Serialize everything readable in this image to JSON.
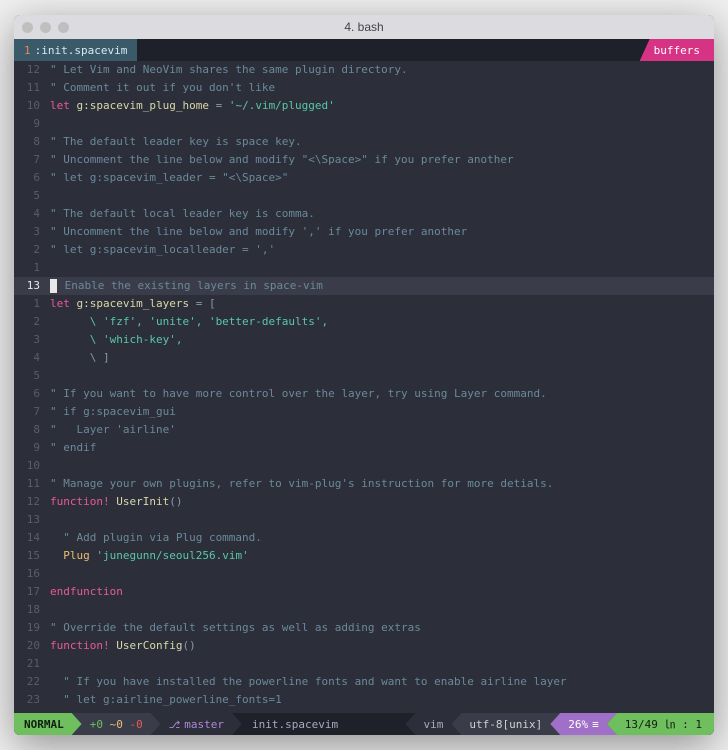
{
  "window": {
    "title": "4. bash"
  },
  "tab": {
    "index": "1",
    "name": "init.spacevim",
    "right_label": "buffers"
  },
  "lines": [
    {
      "n": "12",
      "t": "comment",
      "text": "\" Let Vim and NeoVim shares the same plugin directory."
    },
    {
      "n": "11",
      "t": "comment",
      "text": "\" Comment it out if you don't like"
    },
    {
      "n": "10",
      "t": "let",
      "kw": "let",
      "id": " g:spacevim_plug_home",
      "op": " = ",
      "str": "'~/.vim/plugged'"
    },
    {
      "n": "9",
      "t": "blank",
      "text": ""
    },
    {
      "n": "8",
      "t": "comment",
      "text": "\" The default leader key is space key."
    },
    {
      "n": "7",
      "t": "comment",
      "text": "\" Uncomment the line below and modify \"<\\Space>\" if you prefer another"
    },
    {
      "n": "6",
      "t": "comment",
      "text": "\" let g:spacevim_leader = \"<\\Space>\""
    },
    {
      "n": "5",
      "t": "blank",
      "text": ""
    },
    {
      "n": "4",
      "t": "comment",
      "text": "\" The default local leader key is comma."
    },
    {
      "n": "3",
      "t": "comment",
      "text": "\" Uncomment the line below and modify ',' if you prefer another"
    },
    {
      "n": "2",
      "t": "comment",
      "text": "\" let g:spacevim_localleader = ','"
    },
    {
      "n": "1",
      "t": "blank",
      "text": ""
    },
    {
      "n": "13",
      "t": "cursor",
      "text": " Enable the existing layers in space-vim"
    },
    {
      "n": "1",
      "t": "let",
      "kw": "let",
      "id": " g:spacevim_layers",
      "op": " = [",
      "str": ""
    },
    {
      "n": "2",
      "t": "strline",
      "text": "      \\ 'fzf', 'unite', 'better-defaults',"
    },
    {
      "n": "3",
      "t": "strline",
      "text": "      \\ 'which-key',"
    },
    {
      "n": "4",
      "t": "op",
      "text": "      \\ ]"
    },
    {
      "n": "5",
      "t": "blank",
      "text": ""
    },
    {
      "n": "6",
      "t": "comment",
      "text": "\" If you want to have more control over the layer, try using Layer command."
    },
    {
      "n": "7",
      "t": "comment",
      "text": "\" if g:spacevim_gui"
    },
    {
      "n": "8",
      "t": "comment",
      "text": "\"   Layer 'airline'"
    },
    {
      "n": "9",
      "t": "comment",
      "text": "\" endif"
    },
    {
      "n": "10",
      "t": "blank",
      "text": ""
    },
    {
      "n": "11",
      "t": "comment",
      "text": "\" Manage your own plugins, refer to vim-plug's instruction for more detials."
    },
    {
      "n": "12",
      "t": "func",
      "kw": "function!",
      "id": " UserInit",
      "op": "()"
    },
    {
      "n": "13",
      "t": "blank",
      "text": ""
    },
    {
      "n": "14",
      "t": "comment",
      "text": "  \" Add plugin via Plug command."
    },
    {
      "n": "15",
      "t": "plug",
      "indent": "  ",
      "fn": "Plug ",
      "str": "'junegunn/seoul256.vim'"
    },
    {
      "n": "16",
      "t": "blank",
      "text": ""
    },
    {
      "n": "17",
      "t": "kw",
      "text": "endfunction"
    },
    {
      "n": "18",
      "t": "blank",
      "text": ""
    },
    {
      "n": "19",
      "t": "comment",
      "text": "\" Override the default settings as well as adding extras"
    },
    {
      "n": "20",
      "t": "func",
      "kw": "function!",
      "id": " UserConfig",
      "op": "()"
    },
    {
      "n": "21",
      "t": "blank",
      "text": ""
    },
    {
      "n": "22",
      "t": "comment",
      "text": "  \" If you have installed the powerline fonts and want to enable airline layer"
    },
    {
      "n": "23",
      "t": "comment",
      "text": "  \" let g:airline_powerline_fonts=1"
    }
  ],
  "status": {
    "mode": "NORMAL",
    "diff_plus": "+0",
    "diff_tilde": "~0",
    "diff_minus": "-0",
    "branch": "master",
    "file": "init.spacevim",
    "filetype": "vim",
    "encoding": "utf-8[unix]",
    "percent": "26%",
    "position": "13/49 ㏑ : 1"
  }
}
